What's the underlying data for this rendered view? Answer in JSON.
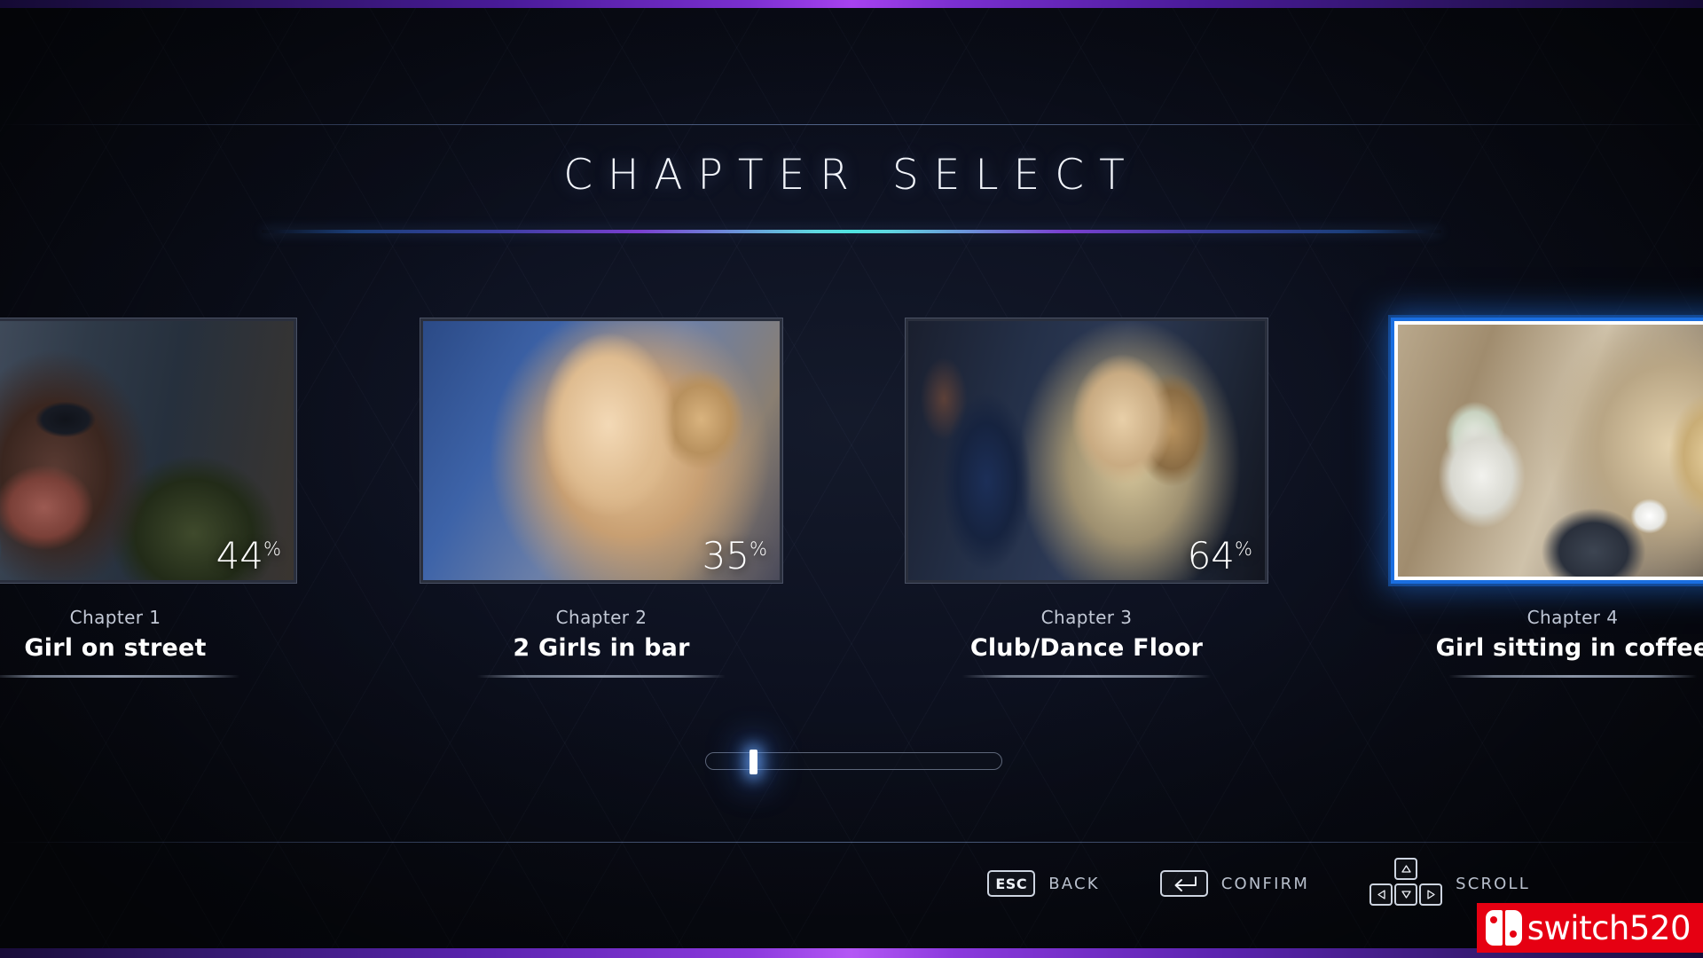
{
  "header": {
    "title": "CHAPTER SELECT"
  },
  "colors": {
    "accent_cyan": "#4fe3e0",
    "accent_purple": "#7a3fd0",
    "selected_border": "#1a6ee0",
    "edge_bar_purple": "#a742ef",
    "watermark_red": "#e60012",
    "text_primary": "#ffffff",
    "text_secondary": "#c3c9d6"
  },
  "carousel": {
    "cards": [
      {
        "chapter_label": "Chapter 1",
        "title": "Girl on street",
        "percent": "44",
        "percent_symbol": "%",
        "selected": false,
        "thumb_name": "thumb-girl-on-street"
      },
      {
        "chapter_label": "Chapter 2",
        "title": "2 Girls in bar",
        "percent": "35",
        "percent_symbol": "%",
        "selected": false,
        "thumb_name": "thumb-2-girls-in-bar"
      },
      {
        "chapter_label": "Chapter 3",
        "title": "Club/Dance Floor",
        "percent": "64",
        "percent_symbol": "%",
        "selected": false,
        "thumb_name": "thumb-club-dance-floor"
      },
      {
        "chapter_label": "Chapter 4",
        "title": "Girl sitting in coffee",
        "percent": "",
        "percent_symbol": "",
        "selected": true,
        "thumb_name": "thumb-girl-sitting-in-coffee"
      }
    ]
  },
  "scrollbar": {
    "thumb_position_percent": 15
  },
  "footer": {
    "hints": [
      {
        "key": "ESC",
        "key_icon": "esc-key",
        "label": "BACK"
      },
      {
        "key": "",
        "key_icon": "enter-key",
        "label": "CONFIRM"
      },
      {
        "key": "",
        "key_icon": "arrow-keys",
        "label": "SCROLL"
      }
    ]
  },
  "watermark": {
    "text": "switch520",
    "logo_icon": "nintendo-switch-logo"
  }
}
